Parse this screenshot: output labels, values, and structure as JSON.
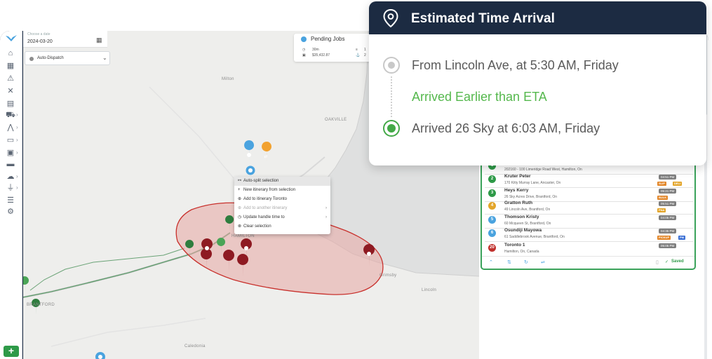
{
  "eta_card": {
    "title": "Estimated Time Arrival",
    "origin": "From Lincoln Ave, at 5:30 AM, Friday",
    "status": "Arrived Earlier than ETA",
    "arrival": "Arrived 26 Sky at 6:03 AM, Friday"
  },
  "date_picker": {
    "caption": "Choose a date",
    "value": "2024-03-20"
  },
  "dispatch": {
    "label": "Auto-Dispatch"
  },
  "pending_jobs": {
    "title": "Pending Jobs",
    "time": "30m",
    "distance": "$35,432.87",
    "count_a": "1",
    "count_b": "2"
  },
  "context_menu": {
    "items": [
      {
        "label": "Auto-split selection",
        "highlighted": true,
        "disabled": false,
        "submenu": false
      },
      {
        "label": "New itinerary from selection",
        "highlighted": false,
        "disabled": false,
        "submenu": false
      },
      {
        "label": "Add to itinerary Toronto",
        "highlighted": false,
        "disabled": false,
        "submenu": false
      },
      {
        "label": "Add to another itinerary",
        "highlighted": false,
        "disabled": true,
        "submenu": true
      },
      {
        "label": "Update handle time to",
        "highlighted": false,
        "disabled": false,
        "submenu": true
      },
      {
        "label": "Clear selection",
        "highlighted": false,
        "disabled": false,
        "submenu": false
      }
    ]
  },
  "map_labels": {
    "oakville": "OAKVILLE",
    "milton": "Milton",
    "hamilton": "HAMILTON",
    "grimsby": "Grimsby",
    "lincoln": "Lincoln",
    "caledonia": "Caledonia",
    "brantford": "BRANTFORD"
  },
  "route_stops": [
    {
      "badge": "1",
      "color": "#2e9a48",
      "name": "",
      "address": "202160 - 100 Limeridge Road West, Hamilton, On",
      "time": "",
      "tags": []
    },
    {
      "badge": "2",
      "color": "#2e9a48",
      "name": "Kruter Peter",
      "address": "170 Kitty Murray Lane, Ancaster, On",
      "time": "04:51 PM",
      "tags": [
        {
          "t": "SLIP",
          "c": "#e3872a"
        },
        {
          "t": "DELI",
          "c": "#e3a52a"
        }
      ]
    },
    {
      "badge": "3",
      "color": "#2e9a48",
      "name": "Heys Kerry",
      "address": "26 Sky Acres Drive, Brantford, On",
      "time": "05:21 PM",
      "tags": [
        {
          "t": "BULK",
          "c": "#e3872a"
        }
      ]
    },
    {
      "badge": "4",
      "color": "#e3a52a",
      "name": "Gratton Ruth",
      "address": "49 Lincoln Ave, Brantford, On",
      "time": "05:51 PM",
      "tags": [
        {
          "t": "FNA",
          "c": "#e3a52a"
        }
      ]
    },
    {
      "badge": "5",
      "color": "#4aa3df",
      "name": "Thomson Kristy",
      "address": "60 Mcqueen St, Brantford, On",
      "time": "04:05 PM",
      "tags": []
    },
    {
      "badge": "6",
      "color": "#4aa3df",
      "name": "Osundiji Mayowa",
      "address": "61 Saddlebrook Avenue, Brantford, On",
      "time": "04:35 PM",
      "tags": [
        {
          "t": "PICKUP",
          "c": "#e3872a"
        },
        {
          "t": "PM",
          "c": "#3b6fd4"
        }
      ]
    },
    {
      "badge": "20",
      "color": "#c0302c",
      "name": "Toronto 1",
      "address": "Hamilton, On, Canada",
      "time": "05:05 PM",
      "tags": []
    }
  ],
  "route_footer": {
    "saved": "Saved"
  },
  "colors": {
    "navy": "#1c2b42",
    "accent_green": "#43a947",
    "status_green": "#55b84d",
    "region_fill": "#e8a7a4",
    "region_stroke": "#c8302c",
    "marker_red": "#8e1a22"
  },
  "icons": {
    "eta_header": "map-pin-icon",
    "sidebar": [
      "home-icon",
      "table-icon",
      "alert-icon",
      "route-icon",
      "id-card-icon",
      "truck-icon",
      "chart-icon",
      "folder-icon",
      "calendar-icon",
      "card-icon",
      "cloud-icon",
      "plug-icon",
      "list-icon",
      "gear-icon"
    ]
  }
}
